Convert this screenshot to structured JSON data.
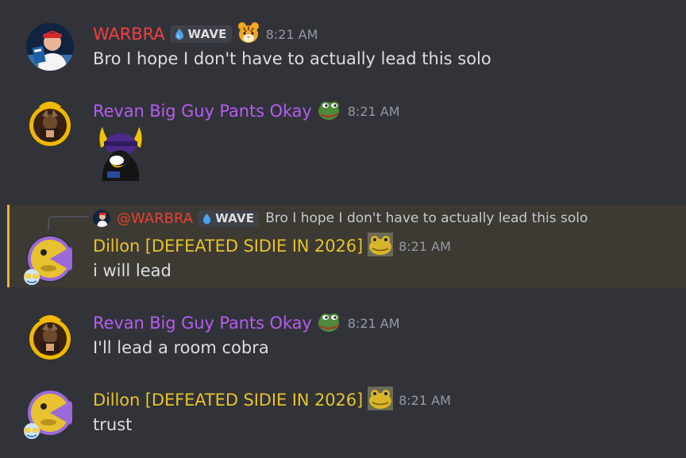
{
  "messages": [
    {
      "username": "WARBRA",
      "username_color": "#f23f42",
      "tag": "WAVE",
      "badge_icon": "tiger-face-icon",
      "time": "8:21 AM",
      "text": "Bro I hope I don't have to actually lead this solo"
    },
    {
      "username": "Revan Big Guy Pants Okay",
      "username_color": "#b65cf0",
      "badge_icon": "pepe-frog-icon",
      "time": "8:21 AM",
      "sticker": "penguin-viking-sticker"
    },
    {
      "reply": {
        "mention": "@WARBRA",
        "tag": "WAVE",
        "text": "Bro I hope I don't have to actually lead this solo"
      },
      "username": "Dillon [DEFEATED SIDIE IN 2026]",
      "username_color": "#e6c32a",
      "badge_icon": "yellow-frog-icon",
      "time": "8:21 AM",
      "text": "i will lead",
      "highlight_color": "#f0b232"
    },
    {
      "username": "Revan Big Guy Pants Okay",
      "username_color": "#b65cf0",
      "badge_icon": "pepe-frog-icon",
      "time": "8:21 AM",
      "text": "I'll lead a room cobra"
    },
    {
      "username": "Dillon [DEFEATED SIDIE IN 2026]",
      "username_color": "#e6c32a",
      "badge_icon": "yellow-frog-icon",
      "time": "8:21 AM",
      "text": "trust"
    }
  ]
}
